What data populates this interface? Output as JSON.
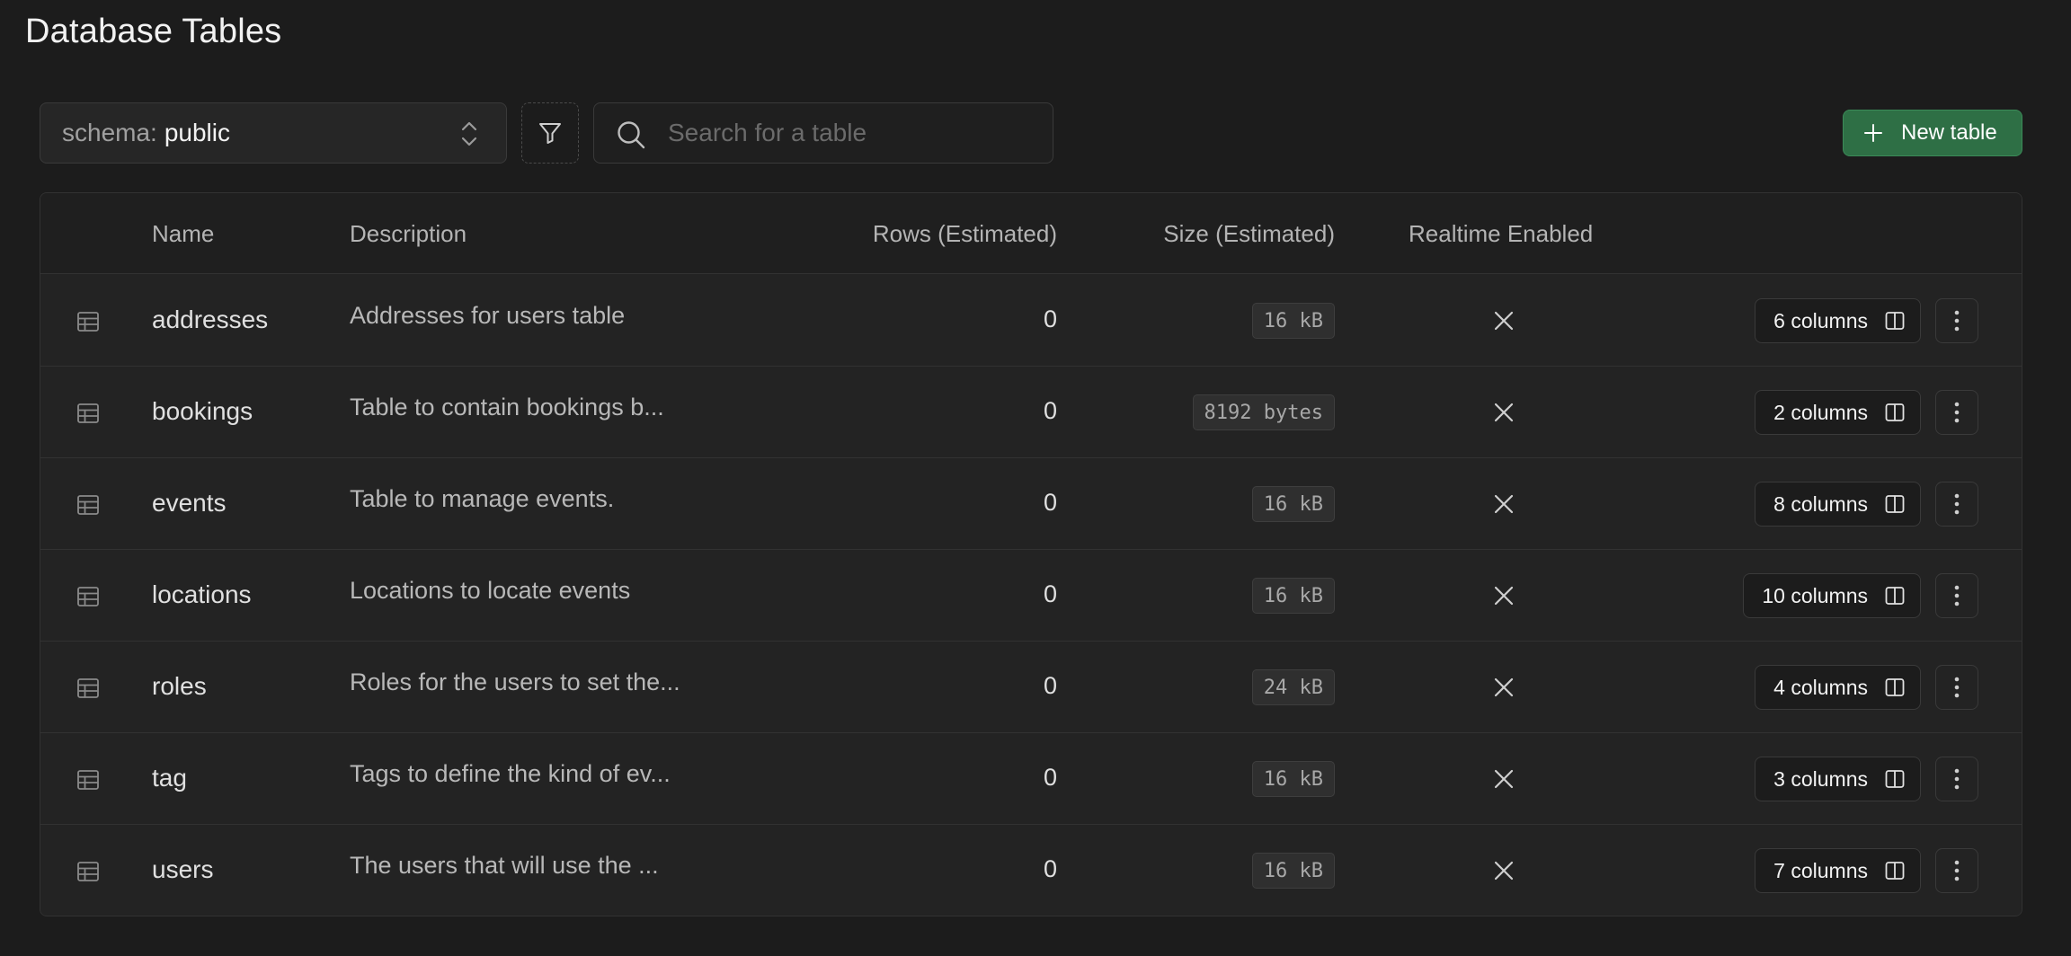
{
  "page": {
    "title": "Database Tables"
  },
  "toolbar": {
    "schema_prefix": "schema:",
    "schema_value": "public",
    "search_placeholder": "Search for a table",
    "search_value": "",
    "new_table_label": "New table"
  },
  "table": {
    "headers": {
      "name": "Name",
      "description": "Description",
      "rows": "Rows (Estimated)",
      "size": "Size (Estimated)",
      "realtime": "Realtime Enabled"
    },
    "rows": [
      {
        "name": "addresses",
        "description": "Addresses for users table",
        "rows": "0",
        "size": "16 kB",
        "realtime": false,
        "columns": "6 columns"
      },
      {
        "name": "bookings",
        "description": "Table to contain bookings b...",
        "rows": "0",
        "size": "8192 bytes",
        "realtime": false,
        "columns": "2 columns"
      },
      {
        "name": "events",
        "description": "Table to manage events.",
        "rows": "0",
        "size": "16 kB",
        "realtime": false,
        "columns": "8 columns"
      },
      {
        "name": "locations",
        "description": "Locations to locate events",
        "rows": "0",
        "size": "16 kB",
        "realtime": false,
        "columns": "10 columns"
      },
      {
        "name": "roles",
        "description": "Roles for the users to set the...",
        "rows": "0",
        "size": "24 kB",
        "realtime": false,
        "columns": "4 columns"
      },
      {
        "name": "tag",
        "description": "Tags to define the kind of ev...",
        "rows": "0",
        "size": "16 kB",
        "realtime": false,
        "columns": "3 columns"
      },
      {
        "name": "users",
        "description": "The users that will use the ...",
        "rows": "0",
        "size": "16 kB",
        "realtime": false,
        "columns": "7 columns"
      }
    ]
  },
  "icons": {
    "schema_select": "chevron-up-down-icon",
    "filter": "filter-icon",
    "search": "search-icon",
    "new_table": "plus-icon",
    "row": "table-icon",
    "realtime_disabled": "x-icon",
    "columns": "columns-split-icon",
    "more": "more-vertical-icon"
  },
  "colors": {
    "background": "#1c1c1c",
    "accent": "#2e6f45"
  }
}
